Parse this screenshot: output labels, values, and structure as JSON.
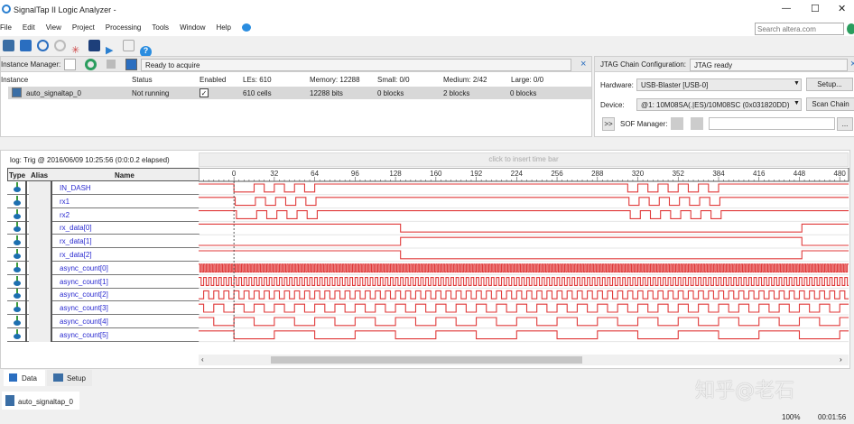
{
  "window": {
    "title": "SignalTap II Logic Analyzer -",
    "minimize": "—",
    "maximize": "☐",
    "close": "✕"
  },
  "menu": [
    "File",
    "Edit",
    "View",
    "Project",
    "Processing",
    "Tools",
    "Window",
    "Help"
  ],
  "search": {
    "placeholder": "Search altera.com"
  },
  "instance_manager": {
    "label": "Instance Manager:",
    "status": "Ready to acquire",
    "close": "×",
    "columns": [
      "Instance",
      "Status",
      "Enabled",
      "LEs: 610",
      "Memory: 12288",
      "Small: 0/0",
      "Medium: 2/42",
      "Large: 0/0"
    ],
    "rows": [
      {
        "instance": "auto_signaltap_0",
        "status": "Not running",
        "enabled": true,
        "les": "610 cells",
        "memory": "12288 bits",
        "small": "0 blocks",
        "medium": "2 blocks",
        "large": "0 blocks"
      }
    ]
  },
  "jtag": {
    "label": "JTAG Chain Configuration:",
    "status": "JTAG ready",
    "close": "×",
    "hardware_label": "Hardware:",
    "hardware": "USB-Blaster [USB-0]",
    "setup": "Setup...",
    "device_label": "Device:",
    "device": "@1: 10M08SA(.|ES)/10M08SC (0x031820DD)",
    "scan": "Scan Chain",
    "expand": ">>",
    "sof_label": "SOF Manager:",
    "browse": "..."
  },
  "waveform": {
    "log": "log: Trig @ 2016/06/09 10:25:56 (0:0:0.2 elapsed)",
    "timebar_hint": "click to insert time bar",
    "headers": {
      "type": "Type",
      "alias": "Alias",
      "name": "Name"
    },
    "ticks": [
      0,
      32,
      64,
      96,
      128,
      160,
      192,
      224,
      256,
      288,
      320,
      352,
      384,
      416,
      448,
      480
    ],
    "range": [
      -28,
      487
    ],
    "trigger": 0,
    "color": "#e03a3a",
    "signals": [
      {
        "name": "IN_DASH",
        "init": 1,
        "edges": [
          0,
          16,
          24,
          32,
          40,
          48,
          56,
          64,
          312,
          320,
          328,
          336,
          344,
          352,
          360,
          368,
          376,
          384
        ]
      },
      {
        "name": "rx1",
        "init": 1,
        "edges": [
          1,
          17,
          25,
          33,
          41,
          49,
          57,
          65,
          313,
          321,
          329,
          337,
          345,
          353,
          361,
          369,
          377,
          385
        ]
      },
      {
        "name": "rx2",
        "init": 1,
        "edges": [
          2,
          18,
          26,
          34,
          42,
          50,
          58,
          66,
          314,
          322,
          330,
          338,
          346,
          354,
          362,
          370,
          378,
          386
        ]
      },
      {
        "name": "rx_data[0]",
        "init": 1,
        "edges": [
          132,
          450
        ]
      },
      {
        "name": "rx_data[1]",
        "init": 0,
        "edges": [
          132,
          450
        ]
      },
      {
        "name": "rx_data[2]",
        "init": 1,
        "edges": [
          132,
          450
        ]
      },
      {
        "name": "async_count[0]",
        "init": 1,
        "period": 2
      },
      {
        "name": "async_count[1]",
        "init": 1,
        "period": 4
      },
      {
        "name": "async_count[2]",
        "init": 1,
        "period": 8
      },
      {
        "name": "async_count[3]",
        "init": 1,
        "period": 16
      },
      {
        "name": "async_count[4]",
        "init": 1,
        "period": 32
      },
      {
        "name": "async_count[5]",
        "init": 0,
        "period": 64
      }
    ]
  },
  "tabs": [
    "Data",
    "Setup"
  ],
  "instance_tab": "auto_signaltap_0",
  "status": {
    "zoom": "100%",
    "time": "00:01:56"
  },
  "watermark": "知乎@老石"
}
